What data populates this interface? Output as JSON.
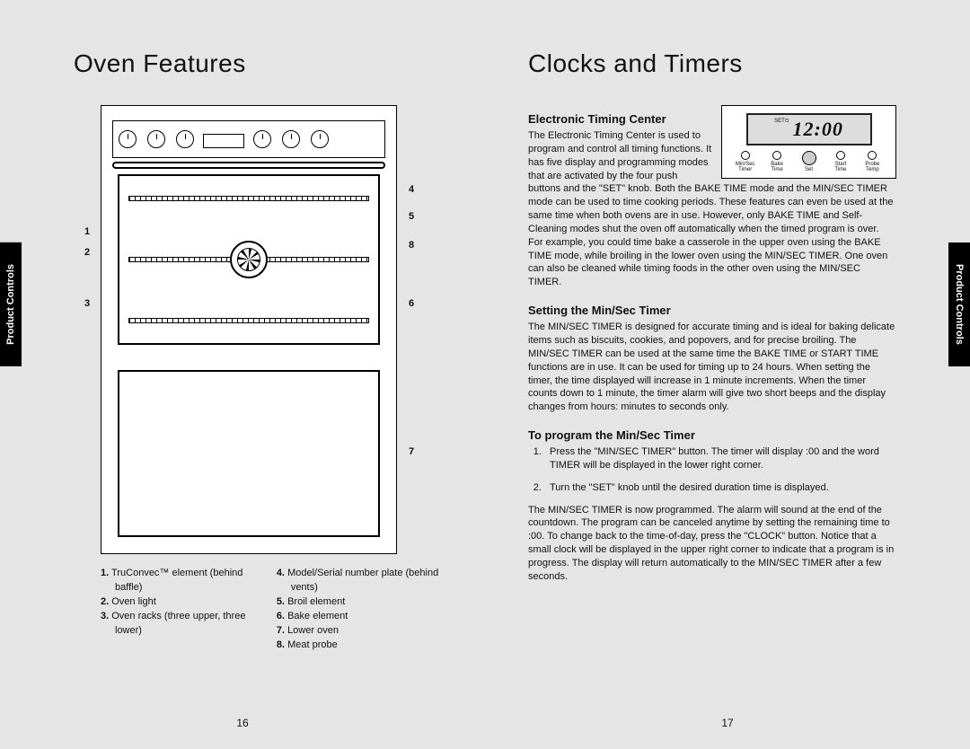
{
  "left": {
    "title": "Oven Features",
    "tab": "Product Controls",
    "pagenum": "16",
    "callouts": {
      "n1": "1",
      "n2": "2",
      "n3": "3",
      "n4": "4",
      "n5": "5",
      "n6": "6",
      "n7": "7",
      "n8": "8"
    },
    "legend_col1": [
      {
        "n": "1.",
        "t": "TruConvec™ element (behind baffle)"
      },
      {
        "n": "2.",
        "t": "Oven light"
      },
      {
        "n": "3.",
        "t": "Oven racks (three upper, three lower)"
      }
    ],
    "legend_col2": [
      {
        "n": "4.",
        "t": "Model/Serial number plate (behind vents)"
      },
      {
        "n": "5.",
        "t": "Broil element"
      },
      {
        "n": "6.",
        "t": "Bake element"
      },
      {
        "n": "7.",
        "t": "Lower oven"
      },
      {
        "n": "8.",
        "t": "Meat probe"
      }
    ]
  },
  "right": {
    "title": "Clocks and Timers",
    "tab": "Product Controls",
    "pagenum": "17",
    "etc": {
      "heading": "Electronic Timing Center",
      "body": "The Electronic Timing Center is used to program and control all timing functions. It has five display and programming modes that are activated by the four push buttons and the \"SET\" knob. Both the BAKE TIME mode and the MIN/SEC TIMER mode can be used to time cooking periods. These features can even be used at the same time when both ovens are in use. However, only BAKE TIME and Self-Cleaning modes shut the oven off automatically when the timed program is over. For example, you could time bake a casserole in the upper oven using the BAKE TIME mode, while broiling in the lower oven using the MIN/SEC TIMER. One oven can also be cleaned while timing foods in the other oven using the MIN/SEC TIMER.",
      "display_set": "SET⏲",
      "display_time": "12:00",
      "btn1a": "Min/Sec",
      "btn1b": "Timer",
      "btn2a": "Bake",
      "btn2b": "Time",
      "btn3": "Set",
      "btn4a": "Start",
      "btn4b": "Time",
      "btn5a": "Probe",
      "btn5b": "Temp"
    },
    "minsec": {
      "heading": "Setting the Min/Sec Timer",
      "body": "The MIN/SEC TIMER is designed for accurate timing and is ideal for baking delicate items such as biscuits, cookies, and popovers, and for precise broiling. The MIN/SEC TIMER can be used at the same time the BAKE TIME or START TIME functions are in use. It can be used for timing up to 24 hours. When setting the timer, the time displayed will increase in 1 minute increments. When the timer counts down to 1 minute, the timer alarm will give two short beeps and the display changes from hours: minutes to seconds only."
    },
    "program": {
      "heading": "To program the Min/Sec Timer",
      "step1": "Press the \"MIN/SEC TIMER\" button. The timer will display :00 and the word TIMER will be displayed in the lower right corner.",
      "step2": "Turn the \"SET\" knob until the desired duration time is displayed.",
      "after": "The MIN/SEC TIMER is now programmed. The alarm will sound at the end of the countdown. The program can be canceled anytime by setting the remaining time to :00. To change back to the time-of-day, press the \"CLOCK\" button. Notice that a small clock will be displayed in the upper right corner to indicate that a program is in progress. The display will return automatically to the MIN/SEC TIMER after a few seconds."
    }
  }
}
